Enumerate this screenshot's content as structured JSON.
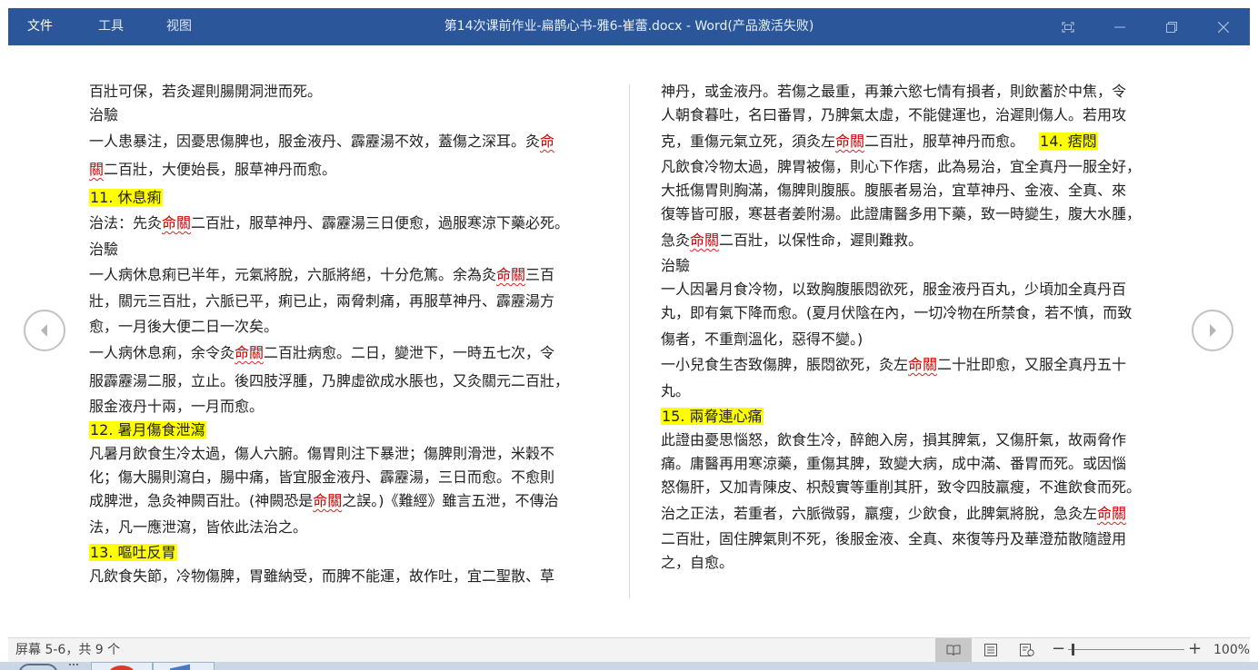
{
  "titlebar": {
    "menu": [
      "文件",
      "工具",
      "视图"
    ],
    "title": "第14次课前作业-扁鹊心书-雅6-崔蕾.docx - Word(产品激活失败)"
  },
  "left_page": {
    "l1": "百壯可保，若灸遲則腸開洞泄而死。",
    "l2": "治驗",
    "l3a": "一人患暴注，因憂思傷脾也，服金液丹、霹靂湯不效，蓋傷之深耳。灸",
    "l3b": "命",
    "l4a": "關",
    "l4b": "二百壯，大便始長，服草神丹而愈。",
    "h11": "11. 休息痢",
    "l6a": "治法：先灸",
    "l6b": "命關",
    "l6c": "二百壯，服草神丹、霹靂湯三日便愈，過服寒涼下藥必死。",
    "l7": "治驗",
    "l8a": "一人病休息痢已半年，元氣將脫，六脈將絕，十分危篤。余為灸",
    "l8b": "命關",
    "l8c": "三百",
    "l9": "壯，關元三百壯，六脈已平，痢已止，兩脅刺痛，再服草神丹、霹靂湯方",
    "l10": "愈，一月後大便二日一次矣。",
    "l11a": "一人病休息痢，余令灸",
    "l11b": "命關",
    "l11c": "二百壯病愈。二日，變泄下，一時五七次，令",
    "l12": "服霹靂湯二服，立止。後四肢浮腫，乃脾虛欲成水脹也，又灸關元二百壯，",
    "l13": "服金液丹十兩，一月而愈。",
    "h12": "12. 暑月傷食泄瀉",
    "l15": "凡暑月飲食生冷太過，傷人六腑。傷胃則注下暴泄；傷脾則滑泄，米穀不",
    "l16": "化；傷大腸則瀉白，腸中痛，皆宜服金液丹、霹靂湯，三日而愈。不愈則",
    "l17a": "成脾泄，急灸神闕百壯。(神闕恐是",
    "l17b": "命關",
    "l17c": "之誤。)《難經》雖言五泄，不傳治",
    "l18": "法，凡一應泄瀉，皆依此法治之。",
    "h13": "13. 嘔吐反胃",
    "l20": "凡飲食失節，冷物傷脾，胃雖納受，而脾不能運，故作吐，宜二聖散、草"
  },
  "right_page": {
    "r1": "神丹，或金液丹。若傷之最重，再兼六慾七情有損者，則飲蓄於中焦，令",
    "r2": "人朝食暮吐，名曰番胃，乃脾氣太虛，不能健運也，治遲則傷人。若用攻",
    "r3a": "克，重傷元氣立死，須灸左",
    "r3b": "命關",
    "r3c": "二百壯，服草神丹而愈。",
    "h14": "14. 痞悶",
    "r4": "凡飲食冷物太過，脾胃被傷，則心下作痞，此為易治，宜全真丹一服全好，",
    "r5": "大抵傷胃則胸滿，傷脾則腹脹。腹脹者易治，宜草神丹、金液、全真、來",
    "r6": "復等皆可服，寒甚者姜附湯。此證庸醫多用下藥，致一時變生，腹大水腫，",
    "r7a": "急灸",
    "r7b": "命關",
    "r7c": "二百壯，以保性命，遲則難救。",
    "r8": "治驗",
    "r9": "一人因暑月食冷物，以致胸腹脹悶欲死，服金液丹百丸，少頃加全真丹百",
    "r10": "丸，即有氣下降而愈。(夏月伏陰在內，一切冷物在所禁食，若不慎，而致",
    "r11": "傷者，不重劑溫化，惡得不變。)",
    "r12a": "一小兒食生杏致傷脾，脹悶欲死，灸左",
    "r12b": "命關",
    "r12c": "二十壯即愈，又服全真丹五十",
    "r13": "丸。",
    "h15": "15. 兩脅連心痛",
    "r15": "此證由憂思惱怒，飲食生冷，醉飽入房，損其脾氣，又傷肝氣，故兩脅作",
    "r16": "痛。庸醫再用寒涼藥，重傷其脾，致變大病，成中滿、番胃而死。或因惱",
    "r17": "怒傷肝，又加青陳皮、枳殼實等重削其肝，致令四肢羸瘦，不進飲食而死。",
    "r18a": "治之正法，若重者，六脈微弱，羸瘦，少飲食，此脾氣將脫，急灸左",
    "r18b": "命關",
    "r19": "二百壯，固住脾氣則不死，後服金液、全真、來復等丹及華澄茄散隨證用",
    "r20": "之，自愈。"
  },
  "statusbar": {
    "page_info": "屏幕 5-6，共 9 个",
    "zoom_minus": "−",
    "zoom_plus": "+",
    "zoom_label": "100%",
    "zoom_percent": 100
  },
  "icons": {
    "prev": "chevron-left-icon",
    "next": "chevron-right-icon",
    "window": [
      "focus-mode-icon",
      "minimize-icon",
      "restore-icon",
      "close-icon"
    ],
    "views": [
      "read-mode-icon",
      "print-layout-icon",
      "web-layout-icon"
    ]
  },
  "colors": {
    "titlebar": "#2b579a",
    "highlight": "#ffff00",
    "spellcheck": "#e02020"
  }
}
